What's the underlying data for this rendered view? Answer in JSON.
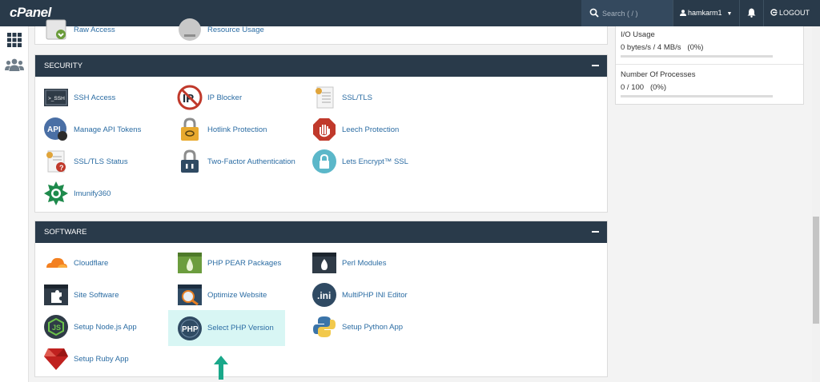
{
  "topbar": {
    "logo": "cPanel",
    "search_placeholder": "Search ( / )",
    "username": "hamkarm1",
    "logout_label": "LOGOUT"
  },
  "partial_row": {
    "items": [
      {
        "label": "Raw Access",
        "icon": "raw-access-icon"
      },
      {
        "label": "Resource Usage",
        "icon": "resource-usage-icon"
      }
    ]
  },
  "security": {
    "title": "SECURITY",
    "items": [
      {
        "label": "SSH Access",
        "icon": "ssh-icon"
      },
      {
        "label": "IP Blocker",
        "icon": "ip-blocker-icon"
      },
      {
        "label": "SSL/TLS",
        "icon": "certificate-icon"
      },
      {
        "label": "Manage API Tokens",
        "icon": "api-icon"
      },
      {
        "label": "Hotlink Protection",
        "icon": "chain-lock-icon"
      },
      {
        "label": "Leech Protection",
        "icon": "hand-stop-icon"
      },
      {
        "label": "SSL/TLS Status",
        "icon": "certificate-status-icon"
      },
      {
        "label": "Two-Factor Authentication",
        "icon": "padlock-icon"
      },
      {
        "label": "Lets Encrypt™ SSL",
        "icon": "lets-encrypt-icon"
      },
      {
        "label": "Imunify360",
        "icon": "imunify-icon"
      }
    ]
  },
  "software": {
    "title": "SOFTWARE",
    "items": [
      {
        "label": "Cloudflare",
        "icon": "cloudflare-icon"
      },
      {
        "label": "PHP PEAR Packages",
        "icon": "pear-icon"
      },
      {
        "label": "Perl Modules",
        "icon": "perl-icon"
      },
      {
        "label": "Site Software",
        "icon": "puzzle-icon"
      },
      {
        "label": "Optimize Website",
        "icon": "optimize-icon"
      },
      {
        "label": "MultiPHP INI Editor",
        "icon": "ini-editor-icon"
      },
      {
        "label": "Setup Node.js App",
        "icon": "nodejs-icon"
      },
      {
        "label": "Select PHP Version",
        "icon": "php-icon"
      },
      {
        "label": "Setup Python App",
        "icon": "python-icon"
      },
      {
        "label": "Setup Ruby App",
        "icon": "ruby-icon"
      }
    ]
  },
  "stats": {
    "io_label": "I/O Usage",
    "io_value": "0 bytes/s / 4 MB/s   (0%)",
    "io_fraction": 0,
    "proc_label": "Number Of Processes",
    "proc_value": "0 / 100   (0%)",
    "proc_fraction": 0
  },
  "colors": {
    "header": "#293a4a",
    "link": "#2b6ca3",
    "highlight": "#d8f6f4",
    "arrow": "#1aa88a"
  }
}
